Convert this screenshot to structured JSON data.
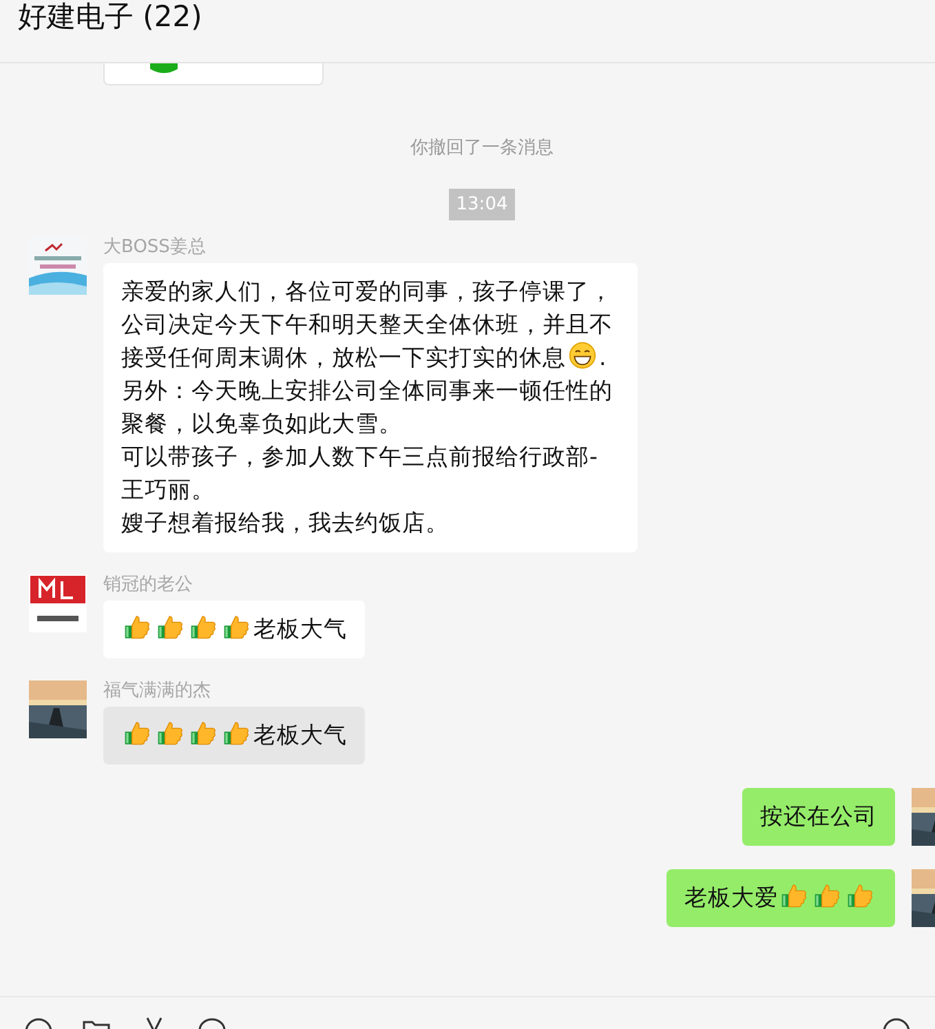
{
  "window": {
    "title": "好建电子 (22)"
  },
  "recall_notice": "你撤回了一条消息",
  "timestamp": "13:04",
  "messages": [
    {
      "sender": "大BOSS姜总",
      "mine": false,
      "avatar": {
        "kind": "logo"
      },
      "highlighted": false,
      "paragraphs": [
        [
          {
            "kind": "text",
            "text": "亲爱的家人们，各位可爱的同事，孩子停课了，公司决定今天下午和明天整天全体休班，并且不接受任何周末调休，放松一下实打实的休息"
          },
          {
            "kind": "grin"
          },
          {
            "kind": "text",
            "text": "."
          }
        ],
        [
          {
            "kind": "text",
            "text": "另外：今天晚上安排公司全体同事来一顿任性的聚餐，以免辜负如此大雪。"
          }
        ],
        [
          {
            "kind": "text",
            "text": "可以带孩子，参加人数下午三点前报给行政部-王巧丽。"
          }
        ],
        [
          {
            "kind": "text",
            "text": "嫂子想着报给我，我去约饭店。"
          }
        ]
      ]
    },
    {
      "sender": "销冠的老公",
      "mine": false,
      "avatar": {
        "kind": "brand"
      },
      "highlighted": false,
      "paragraphs": [
        [
          {
            "kind": "thumbs"
          },
          {
            "kind": "thumbs"
          },
          {
            "kind": "thumbs"
          },
          {
            "kind": "thumbs"
          },
          {
            "kind": "text",
            "text": "老板大气"
          }
        ]
      ]
    },
    {
      "sender": "福气满满的杰",
      "mine": false,
      "avatar": {
        "kind": "picture"
      },
      "highlighted": true,
      "paragraphs": [
        [
          {
            "kind": "thumbs"
          },
          {
            "kind": "thumbs"
          },
          {
            "kind": "thumbs"
          },
          {
            "kind": "thumbs"
          },
          {
            "kind": "text",
            "text": "老板大气"
          }
        ]
      ]
    },
    {
      "mine": true,
      "avatar": {
        "kind": "picture"
      },
      "highlighted": false,
      "paragraphs": [
        [
          {
            "kind": "text",
            "text": "按还在公司"
          }
        ]
      ]
    },
    {
      "mine": true,
      "avatar": {
        "kind": "picture"
      },
      "highlighted": false,
      "paragraphs": [
        [
          {
            "kind": "text",
            "text": "老板大爱"
          },
          {
            "kind": "thumbs"
          },
          {
            "kind": "thumbs"
          },
          {
            "kind": "thumbs"
          }
        ]
      ]
    }
  ]
}
